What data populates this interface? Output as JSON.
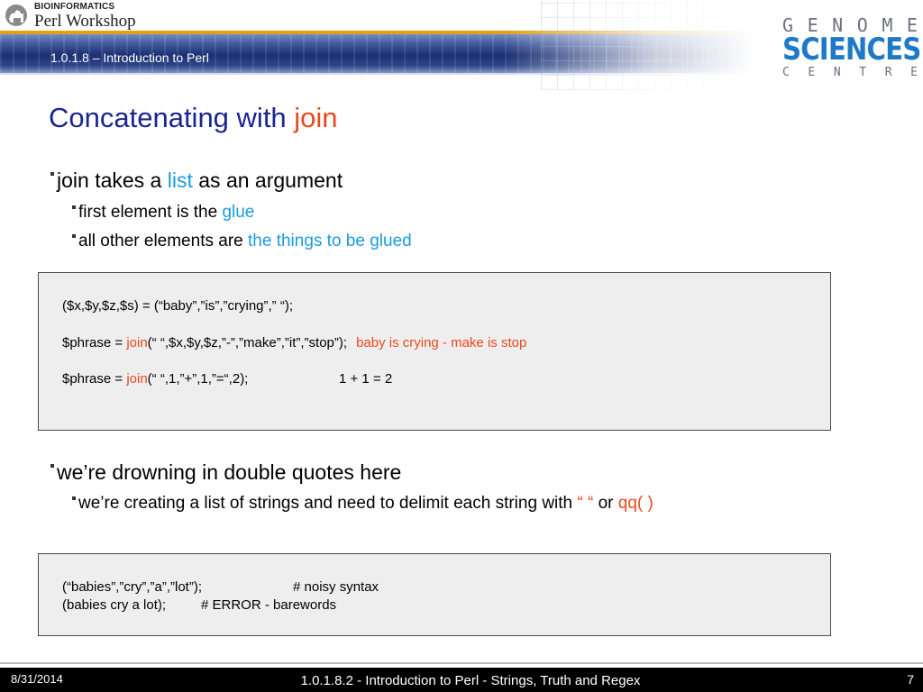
{
  "header": {
    "logo_line1": "BIOINFORMATICS",
    "logo_line2": "Perl Workshop",
    "course_title": "1.0.1.8 – Introduction to Perl",
    "gsc_top": [
      "G",
      "E",
      "N",
      "O",
      "M",
      "E"
    ],
    "gsc_mid": "SCIENCES",
    "gsc_bottom": [
      "C",
      "E",
      "N",
      "T",
      "R",
      "E"
    ]
  },
  "slide": {
    "title_text": "Concatenating with ",
    "title_keyword": "join"
  },
  "bullets": {
    "b1": {
      "pre": "join takes a ",
      "hl": "list",
      "post": " as an argument"
    },
    "b1a": {
      "pre": "first element is the ",
      "hl": "glue"
    },
    "b1b": {
      "pre": "all other elements are ",
      "hl": "the things to be glued"
    },
    "b2": {
      "text": "we’re drowning in double quotes here"
    },
    "b2a": {
      "pre": "we’re creating a list of strings and need to delimit each string with ",
      "hl1": "“ “",
      "mid": " or ",
      "hl2": "qq( )"
    }
  },
  "code1": {
    "line1": "($x,$y,$z,$s) = (“baby”,”is”,”crying”,” “);",
    "line2_pre": "$phrase = ",
    "line2_fn": "join",
    "line2_args": "(“ “,$x,$y,$z,”-”,”make”,”it”,”stop”);",
    "line2_result": "baby is crying - make is stop",
    "line3_pre": "$phrase = ",
    "line3_fn": "join",
    "line3_args": "(“ “,1,”+”,1,”=“,2);",
    "line3_result": "1 + 1 = 2"
  },
  "code2": {
    "line1_code": "(“babies”,”cry”,”a”,”lot”);",
    "line1_comment": "# noisy syntax",
    "line2_code": "(babies cry a lot);",
    "line2_comment": "# ERROR - barewords"
  },
  "footer": {
    "date": "8/31/2014",
    "center": "1.0.1.8.2 - Introduction to Perl - Strings, Truth and Regex",
    "page": "7"
  },
  "colors": {
    "title": "#1a2592",
    "keyword_red": "#e8491e",
    "highlight_blue": "#1a9be0",
    "code_bg": "#eeeeee",
    "footer_bg": "#000000",
    "header_band": "#1b2f73",
    "header_stripe": "#e1a21a"
  }
}
